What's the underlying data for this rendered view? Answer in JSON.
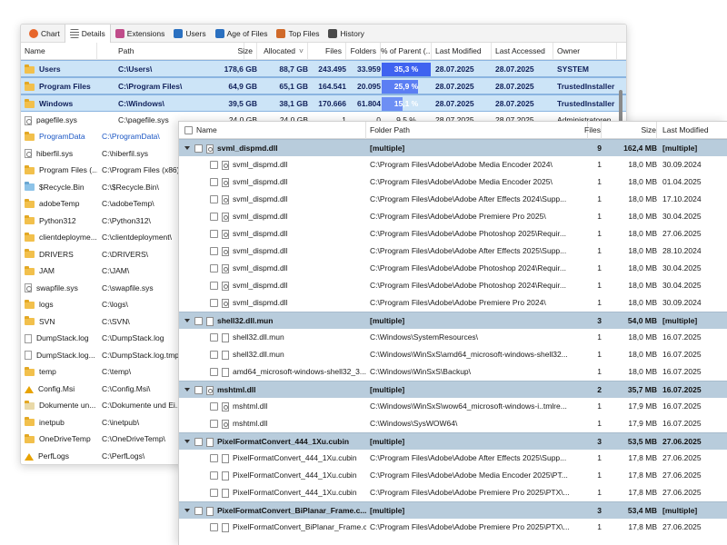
{
  "back_window": {
    "tabs": [
      {
        "label": "Chart",
        "icon": "pie-chart-icon",
        "color": "#e7662b"
      },
      {
        "label": "Details",
        "icon": "details-list-icon",
        "color": "#555555"
      },
      {
        "label": "Extensions",
        "icon": "extensions-icon",
        "color": "#c04c8a"
      },
      {
        "label": "Users",
        "icon": "users-icon",
        "color": "#2a70c0"
      },
      {
        "label": "Age of Files",
        "icon": "calendar-icon",
        "color": "#2a70c0"
      },
      {
        "label": "Top Files",
        "icon": "top-files-icon",
        "color": "#d06a2a"
      },
      {
        "label": "History",
        "icon": "history-icon",
        "color": "#4a4a4a"
      }
    ],
    "columns": {
      "name": "Name",
      "path": "Path",
      "size": "Size",
      "allocated": "Allocated",
      "allocated_sort": "˅",
      "files": "Files",
      "folders": "Folders",
      "pct": "% of Parent (...",
      "modified": "Last Modified",
      "accessed": "Last Accessed",
      "owner": "Owner"
    },
    "selected_rows": [
      {
        "name": "Users",
        "path": "C:\\Users\\",
        "size": "178,6 GB",
        "allocated": "88,7 GB",
        "files": "243.495",
        "folders": "33.959",
        "pct": "35,3 %",
        "pct_value": 35.3,
        "modified": "28.07.2025",
        "accessed": "28.07.2025",
        "owner": "SYSTEM"
      },
      {
        "name": "Program Files",
        "path": "C:\\Program Files\\",
        "size": "64,9 GB",
        "allocated": "65,1 GB",
        "files": "164.541",
        "folders": "20.095",
        "pct": "25,9 %",
        "pct_value": 25.9,
        "modified": "28.07.2025",
        "accessed": "28.07.2025",
        "owner": "TrustedInstaller"
      },
      {
        "name": "Windows",
        "path": "C:\\Windows\\",
        "size": "39,5 GB",
        "allocated": "38,1 GB",
        "files": "170.666",
        "folders": "61.804",
        "pct": "15,1 %",
        "pct_value": 15.1,
        "modified": "28.07.2025",
        "accessed": "28.07.2025",
        "owner": "TrustedInstaller"
      }
    ],
    "partial_row": {
      "name": "pagefile.sys",
      "path": "C:\\pagefile.sys",
      "size": "24,0 GB",
      "allocated": "24,0 GB",
      "files": "1",
      "folders": "0",
      "pct": "9,5 %",
      "modified": "28.07.2025",
      "accessed": "28.07.2025",
      "owner": "Administratoren"
    },
    "rows": [
      {
        "name": "ProgramData",
        "path": "C:\\ProgramData\\",
        "type": "folder",
        "blue": true
      },
      {
        "name": "hiberfil.sys",
        "path": "C:\\hiberfil.sys",
        "type": "sysfile"
      },
      {
        "name": "Program Files (...",
        "path": "C:\\Program Files (x86)\\",
        "type": "folder"
      },
      {
        "name": "$Recycle.Bin",
        "path": "C:\\$Recycle.Bin\\",
        "type": "recycle"
      },
      {
        "name": "adobeTemp",
        "path": "C:\\adobeTemp\\",
        "type": "folder"
      },
      {
        "name": "Python312",
        "path": "C:\\Python312\\",
        "type": "folder"
      },
      {
        "name": "clientdeployme...",
        "path": "C:\\clientdeployment\\",
        "type": "folder"
      },
      {
        "name": "DRIVERS",
        "path": "C:\\DRIVERS\\",
        "type": "folder"
      },
      {
        "name": "JAM",
        "path": "C:\\JAM\\",
        "type": "folder"
      },
      {
        "name": "swapfile.sys",
        "path": "C:\\swapfile.sys",
        "type": "sysfile"
      },
      {
        "name": "logs",
        "path": "C:\\logs\\",
        "type": "folder"
      },
      {
        "name": "SVN",
        "path": "C:\\SVN\\",
        "type": "folder"
      },
      {
        "name": "DumpStack.log",
        "path": "C:\\DumpStack.log",
        "type": "file"
      },
      {
        "name": "DumpStack.log...",
        "path": "C:\\DumpStack.log.tmp",
        "type": "file"
      },
      {
        "name": "temp",
        "path": "C:\\temp\\",
        "type": "folder"
      },
      {
        "name": "Config.Msi",
        "path": "C:\\Config.Msi\\",
        "type": "warn"
      },
      {
        "name": "Dokumente un...",
        "path": "C:\\Dokumente und Ei...",
        "type": "shortcut"
      },
      {
        "name": "inetpub",
        "path": "C:\\inetpub\\",
        "type": "folder"
      },
      {
        "name": "OneDriveTemp",
        "path": "C:\\OneDriveTemp\\",
        "type": "folder"
      },
      {
        "name": "PerfLogs",
        "path": "C:\\PerfLogs\\",
        "type": "warn"
      }
    ]
  },
  "front_window": {
    "columns": {
      "name": "Name",
      "folder_path": "Folder Path",
      "files": "Files",
      "size": "Size",
      "modified": "Last Modified"
    },
    "groups": [
      {
        "name": "svml_dispmd.dll",
        "path": "[multiple]",
        "files": "9",
        "size": "162,4 MB",
        "modified": "[multiple]",
        "icon": "gear",
        "children": [
          {
            "name": "svml_dispmd.dll",
            "path": "C:\\Program Files\\Adobe\\Adobe Media Encoder 2024\\",
            "files": "1",
            "size": "18,0 MB",
            "modified": "30.09.2024"
          },
          {
            "name": "svml_dispmd.dll",
            "path": "C:\\Program Files\\Adobe\\Adobe Media Encoder 2025\\",
            "files": "1",
            "size": "18,0 MB",
            "modified": "01.04.2025"
          },
          {
            "name": "svml_dispmd.dll",
            "path": "C:\\Program Files\\Adobe\\Adobe After Effects 2024\\Supp...",
            "files": "1",
            "size": "18,0 MB",
            "modified": "17.10.2024"
          },
          {
            "name": "svml_dispmd.dll",
            "path": "C:\\Program Files\\Adobe\\Adobe Premiere Pro 2025\\",
            "files": "1",
            "size": "18,0 MB",
            "modified": "30.04.2025"
          },
          {
            "name": "svml_dispmd.dll",
            "path": "C:\\Program Files\\Adobe\\Adobe Photoshop 2025\\Requir...",
            "files": "1",
            "size": "18,0 MB",
            "modified": "27.06.2025"
          },
          {
            "name": "svml_dispmd.dll",
            "path": "C:\\Program Files\\Adobe\\Adobe After Effects 2025\\Supp...",
            "files": "1",
            "size": "18,0 MB",
            "modified": "28.10.2024"
          },
          {
            "name": "svml_dispmd.dll",
            "path": "C:\\Program Files\\Adobe\\Adobe Photoshop 2024\\Requir...",
            "files": "1",
            "size": "18,0 MB",
            "modified": "30.04.2025"
          },
          {
            "name": "svml_dispmd.dll",
            "path": "C:\\Program Files\\Adobe\\Adobe Photoshop 2024\\Requir...",
            "files": "1",
            "size": "18,0 MB",
            "modified": "30.04.2025"
          },
          {
            "name": "svml_dispmd.dll",
            "path": "C:\\Program Files\\Adobe\\Adobe Premiere Pro 2024\\",
            "files": "1",
            "size": "18,0 MB",
            "modified": "30.09.2024"
          }
        ]
      },
      {
        "name": "shell32.dll.mun",
        "path": "[multiple]",
        "files": "3",
        "size": "54,0 MB",
        "modified": "[multiple]",
        "icon": "plain",
        "children": [
          {
            "name": "shell32.dll.mun",
            "path": "C:\\Windows\\SystemResources\\",
            "files": "1",
            "size": "18,0 MB",
            "modified": "16.07.2025"
          },
          {
            "name": "shell32.dll.mun",
            "path": "C:\\Windows\\WinSxS\\amd64_microsoft-windows-shell32...",
            "files": "1",
            "size": "18,0 MB",
            "modified": "16.07.2025"
          },
          {
            "name": "amd64_microsoft-windows-shell32_3...",
            "path": "C:\\Windows\\WinSxS\\Backup\\",
            "files": "1",
            "size": "18,0 MB",
            "modified": "16.07.2025"
          }
        ]
      },
      {
        "name": "mshtml.dll",
        "path": "[multiple]",
        "files": "2",
        "size": "35,7 MB",
        "modified": "16.07.2025",
        "icon": "gear",
        "children": [
          {
            "name": "mshtml.dll",
            "path": "C:\\Windows\\WinSxS\\wow64_microsoft-windows-i..tmlre...",
            "files": "1",
            "size": "17,9 MB",
            "modified": "16.07.2025"
          },
          {
            "name": "mshtml.dll",
            "path": "C:\\Windows\\SysWOW64\\",
            "files": "1",
            "size": "17,9 MB",
            "modified": "16.07.2025"
          }
        ]
      },
      {
        "name": "PixelFormatConvert_444_1Xu.cubin",
        "path": "[multiple]",
        "files": "3",
        "size": "53,5 MB",
        "modified": "27.06.2025",
        "icon": "plain",
        "children": [
          {
            "name": "PixelFormatConvert_444_1Xu.cubin",
            "path": "C:\\Program Files\\Adobe\\Adobe After Effects 2025\\Supp...",
            "files": "1",
            "size": "17,8 MB",
            "modified": "27.06.2025"
          },
          {
            "name": "PixelFormatConvert_444_1Xu.cubin",
            "path": "C:\\Program Files\\Adobe\\Adobe Media Encoder 2025\\PT...",
            "files": "1",
            "size": "17,8 MB",
            "modified": "27.06.2025"
          },
          {
            "name": "PixelFormatConvert_444_1Xu.cubin",
            "path": "C:\\Program Files\\Adobe\\Adobe Premiere Pro 2025\\PTX\\...",
            "files": "1",
            "size": "17,8 MB",
            "modified": "27.06.2025"
          }
        ]
      },
      {
        "name": "PixelFormatConvert_BiPlanar_Frame.c...",
        "path": "[multiple]",
        "files": "3",
        "size": "53,4 MB",
        "modified": "[multiple]",
        "icon": "plain",
        "children": [
          {
            "name": "PixelFormatConvert_BiPlanar_Frame.c...",
            "path": "C:\\Program Files\\Adobe\\Adobe Premiere Pro 2025\\PTX\\...",
            "files": "1",
            "size": "17,8 MB",
            "modified": "27.06.2025"
          }
        ]
      }
    ]
  }
}
